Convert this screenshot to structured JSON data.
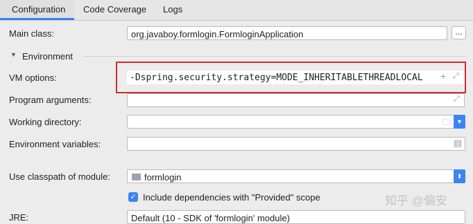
{
  "tabs": [
    {
      "label": "Configuration"
    },
    {
      "label": "Code Coverage"
    },
    {
      "label": "Logs"
    }
  ],
  "main_class": {
    "label": "Main class:",
    "value": "org.javaboy.formlogin.FormloginApplication",
    "browse": "..."
  },
  "environment": {
    "label": "Environment"
  },
  "vm_options": {
    "label": "VM options:",
    "value": "-Dspring.security.strategy=MODE_INHERITABLETHREADLOCAL"
  },
  "program_arguments": {
    "label": "Program arguments:",
    "value": ""
  },
  "working_directory": {
    "label": "Working directory:",
    "value": ""
  },
  "environment_variables": {
    "label": "Environment variables:",
    "value": ""
  },
  "classpath_module": {
    "label": "Use classpath of module:",
    "value": "formlogin"
  },
  "include_dependencies": {
    "label": "Include dependencies with \"Provided\" scope",
    "checked": true
  },
  "jre": {
    "label": "JRE:",
    "value": "Default (10 - SDK of 'formlogin' module)"
  },
  "watermark": {
    "text": "知乎 @偏安"
  },
  "colors": {
    "accent": "#3d84f3",
    "highlight": "#d22b2b"
  }
}
